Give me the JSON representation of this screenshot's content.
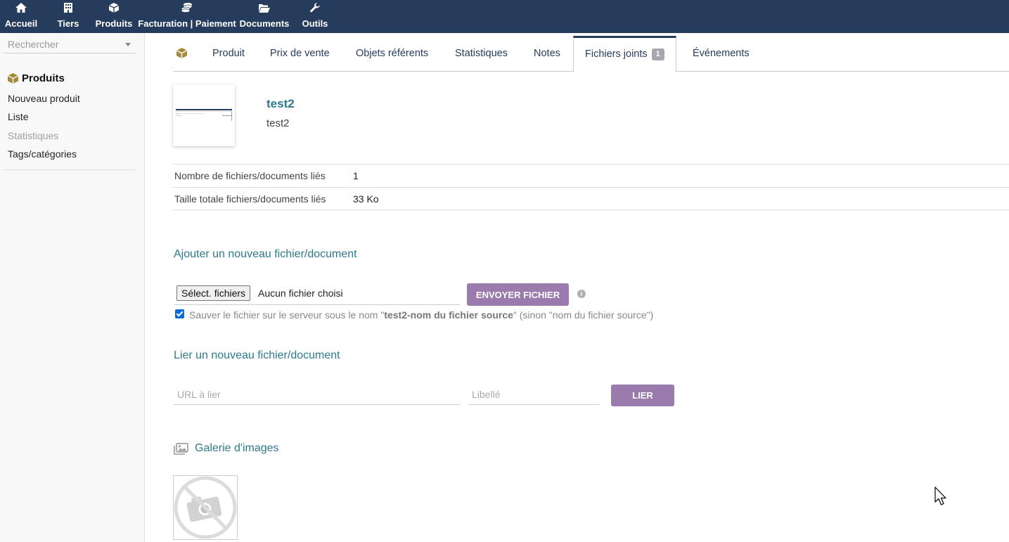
{
  "topnav": [
    {
      "label": "Accueil",
      "icon": "home-icon"
    },
    {
      "label": "Tiers",
      "icon": "building-icon"
    },
    {
      "label": "Produits",
      "icon": "cube-icon"
    },
    {
      "label": "Facturation | Paiement",
      "icon": "coins-icon"
    },
    {
      "label": "Documents",
      "icon": "folder-open-icon"
    },
    {
      "label": "Outils",
      "icon": "wrench-icon"
    }
  ],
  "sidebar": {
    "search_placeholder": "Rechercher",
    "title": "Produits",
    "links": [
      "Nouveau produit",
      "Liste",
      "Statistiques",
      "Tags/catégories"
    ]
  },
  "tabs": [
    {
      "label": "Produit"
    },
    {
      "label": "Prix de vente"
    },
    {
      "label": "Objets référents"
    },
    {
      "label": "Statistiques"
    },
    {
      "label": "Notes"
    },
    {
      "label": "Fichiers joints",
      "badge": "1",
      "active": true
    },
    {
      "label": "Événements"
    }
  ],
  "product": {
    "ref": "test2",
    "label": "test2"
  },
  "info": [
    {
      "key": "Nombre de fichiers/documents liés",
      "value": "1"
    },
    {
      "key": "Taille totale fichiers/documents liés",
      "value": "33 Ko"
    }
  ],
  "upload": {
    "title": "Ajouter un nouveau fichier/document",
    "select_button": "Sélect. fichiers",
    "no_file": "Aucun fichier choisi",
    "send_button": "ENVOYER FICHIER",
    "info_glyph": "i",
    "checkbox_prefix": "Sauver le fichier sur le serveur sous le nom \"",
    "checkbox_bold": "test2-nom du fichier source",
    "checkbox_suffix": "\" (sinon \"nom du fichier source\")"
  },
  "link": {
    "title": "Lier un nouveau fichier/document",
    "url_placeholder": "URL à lier",
    "label_placeholder": "Libellé",
    "button": "LIER"
  },
  "gallery": {
    "title": "Galerie d'images"
  },
  "colors": {
    "topbar": "#263c5c",
    "accent": "#2c7a8c",
    "button": "#9b7bad",
    "product_icon": "#a48b3a"
  }
}
